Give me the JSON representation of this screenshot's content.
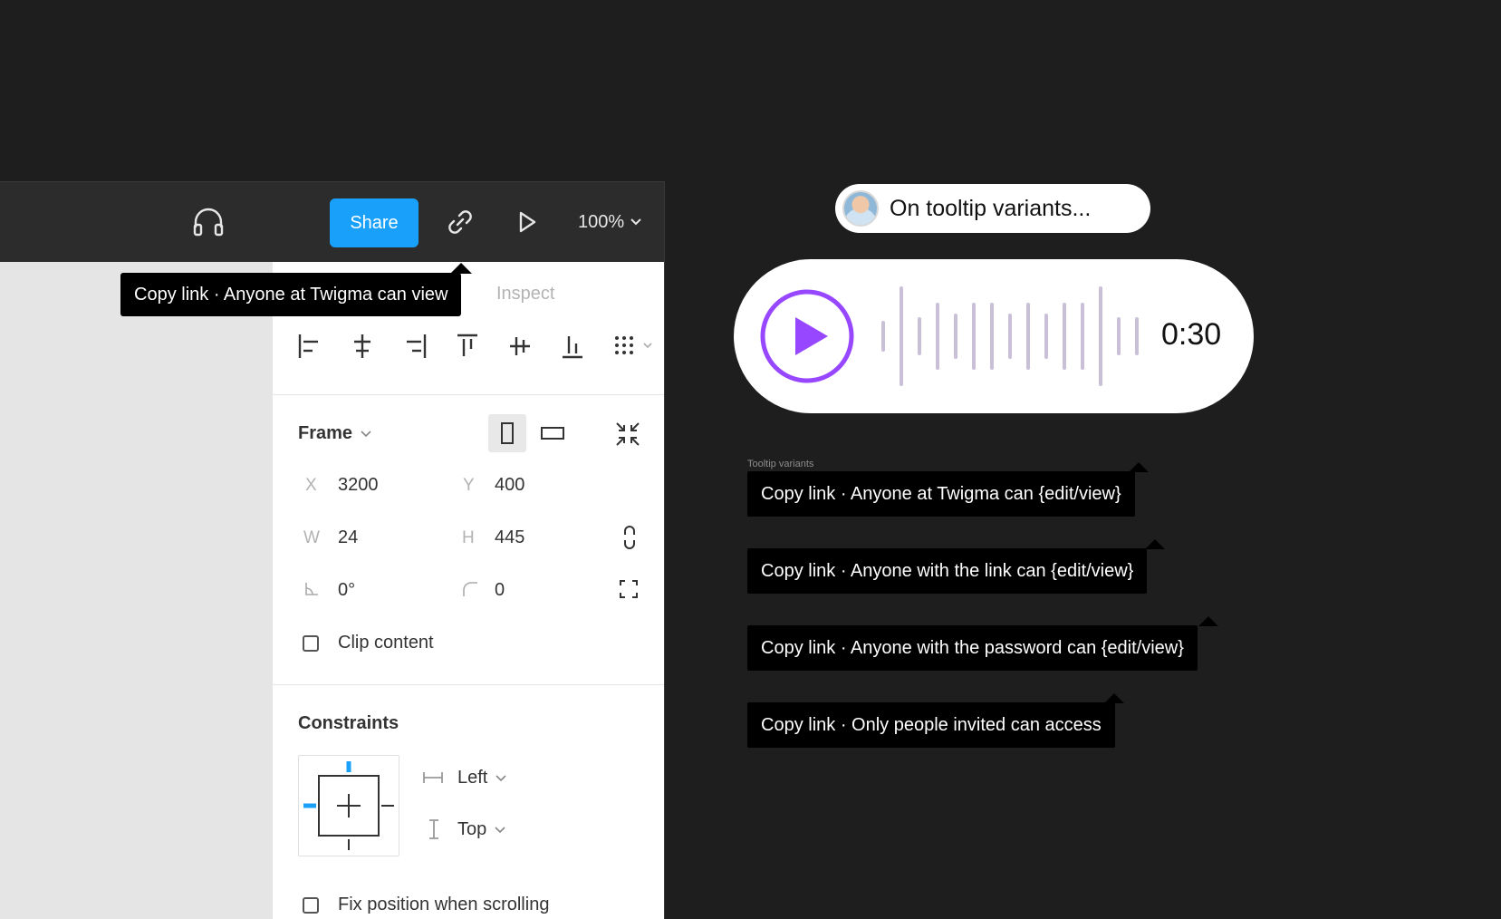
{
  "toolbar": {
    "share_label": "Share",
    "zoom_value": "100%"
  },
  "tabs": {
    "inspect_label": "Inspect"
  },
  "tooltip_main": "Copy link · Anyone at Twigma can view",
  "frame": {
    "title": "Frame",
    "x_label": "X",
    "x_value": "3200",
    "y_label": "Y",
    "y_value": "400",
    "w_label": "W",
    "w_value": "24",
    "h_label": "H",
    "h_value": "445",
    "rotation_value": "0°",
    "radius_value": "0",
    "clip_content_label": "Clip content"
  },
  "constraints": {
    "title": "Constraints",
    "horizontal": "Left",
    "vertical": "Top",
    "fix_position_label": "Fix position when scrolling"
  },
  "comment": {
    "text": "On tooltip variants..."
  },
  "audio": {
    "time": "0:30"
  },
  "variants": {
    "label": "Tooltip variants",
    "items": [
      "Copy link · Anyone at Twigma can {edit/view}",
      "Copy link · Anyone with the link can {edit/view}",
      "Copy link · Anyone with the password can {edit/view}",
      "Copy link · Only people invited can access"
    ]
  },
  "colors": {
    "accent": "#18a0fb",
    "play": "#9747ff",
    "waveform": "#c9bfd6"
  }
}
